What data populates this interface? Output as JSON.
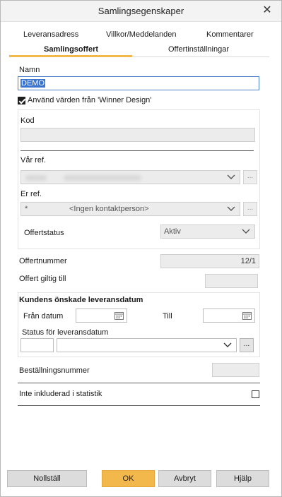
{
  "window": {
    "title": "Samlingsegenskaper",
    "close_glyph": "✕"
  },
  "tabs": {
    "row1": [
      "Leveransadress",
      "Villkor/Meddelanden",
      "Kommentarer"
    ],
    "row2": [
      "Samlingsoffert",
      "Offertinställningar"
    ],
    "active": "Samlingsoffert"
  },
  "form": {
    "namn_label": "Namn",
    "namn_value": "DEMO",
    "use_winner_label": "Använd värden från 'Winner Design'",
    "use_winner_checked": true,
    "kod_label": "Kod",
    "kod_value": "",
    "var_ref_label": "Vår ref.",
    "er_ref_label": "Er ref.",
    "er_ref_prefix": "*",
    "er_ref_value": "<Ingen kontaktperson>",
    "offertstatus_label": "Offertstatus",
    "offertstatus_value": "Aktiv",
    "offertnummer_label": "Offertnummer",
    "offertnummer_value": "12/1",
    "offert_giltig_label": "Offert giltig till",
    "offert_giltig_value": "",
    "ellipsis": "..."
  },
  "delivery": {
    "heading": "Kundens önskade leveransdatum",
    "fran_label": "Från datum",
    "till_label": "Till",
    "status_label": "Status för leveransdatum"
  },
  "bestallning_label": "Beställningsnummer",
  "statistik_label": "Inte inkluderad i statistik",
  "statistik_checked": false,
  "buttons": {
    "reset": "Nollställ",
    "ok": "OK",
    "cancel": "Avbryt",
    "help": "Hjälp"
  },
  "colors": {
    "accent": "#f2b84b",
    "selection": "#3874d0"
  }
}
